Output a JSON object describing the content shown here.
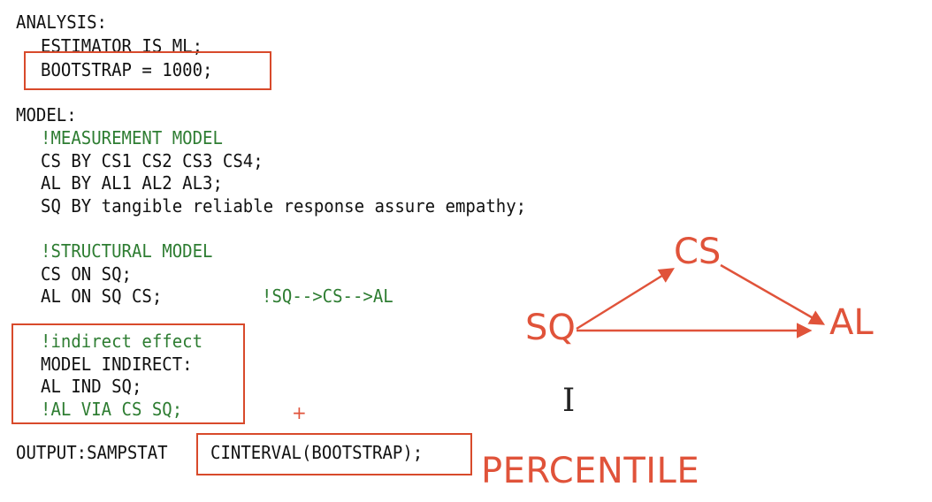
{
  "code": {
    "analysis_header": "ANALYSIS:",
    "estimator": "ESTIMATOR IS ML;",
    "bootstrap": "BOOTSTRAP = 1000;",
    "model_header": "MODEL:",
    "measurement_comment": "!MEASUREMENT MODEL",
    "cs_by": "CS BY CS1 CS2 CS3 CS4;",
    "al_by": "AL BY AL1 AL2 AL3;",
    "sq_by": "SQ BY tangible reliable response assure empathy;",
    "structural_comment": "!STRUCTURAL MODEL",
    "cs_on": "CS ON SQ;",
    "al_on": "AL ON SQ CS;",
    "path_comment": "!SQ-->CS-->AL",
    "indirect_comment": "!indirect effect",
    "model_indirect": "MODEL INDIRECT:",
    "al_ind": "AL IND SQ;",
    "al_via": "!AL VIA CS SQ;",
    "output_prefix": "OUTPUT:SAMPSTAT",
    "cinterval": "CINTERVAL(BOOTSTRAP);"
  },
  "annotations": {
    "plus_sign": "+",
    "percentile": "PERCENTILE",
    "color": "#e0533a"
  },
  "diagram": {
    "node_sq": "SQ",
    "node_cs": "CS",
    "node_al": "AL",
    "edges": [
      {
        "from": "SQ",
        "to": "CS"
      },
      {
        "from": "CS",
        "to": "AL"
      },
      {
        "from": "SQ",
        "to": "AL"
      }
    ]
  },
  "cursor": {
    "icon": "text-cursor-icon",
    "glyph": "I"
  }
}
